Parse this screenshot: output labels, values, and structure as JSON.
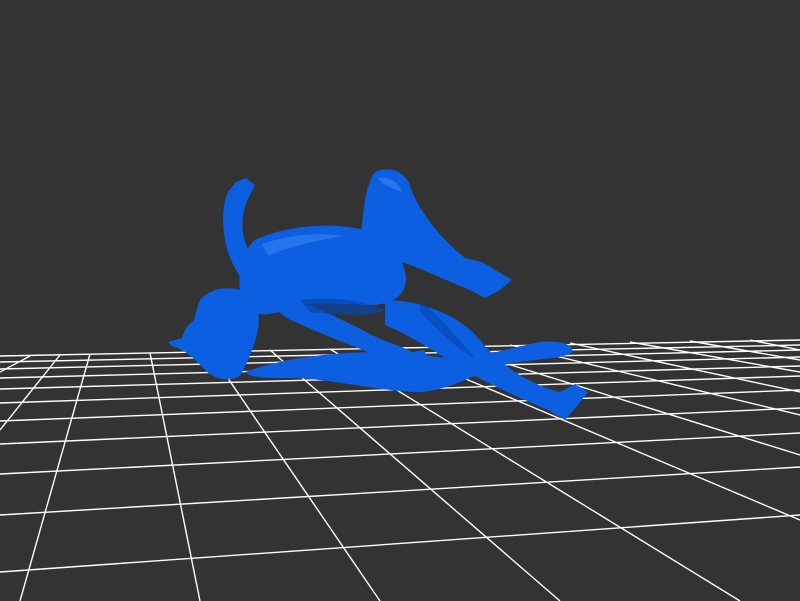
{
  "viewer": {
    "background_color": "#333333",
    "grid_color": "#ffffff",
    "grid_visible": true,
    "model_color": "#0b5fe0",
    "model_shadow_color": "#0845aa",
    "model_highlight_color": "#2f7df0"
  },
  "model": {
    "subject": "figure-reclining-pose"
  }
}
